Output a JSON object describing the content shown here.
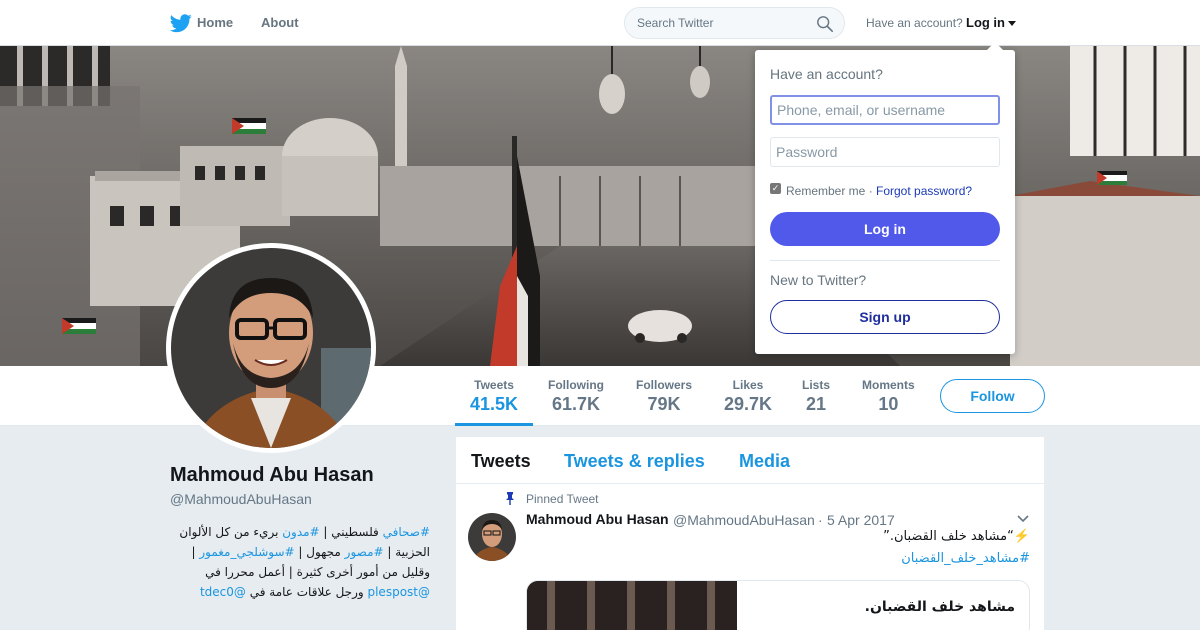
{
  "nav": {
    "home_label": "Home",
    "about_label": "About",
    "search_placeholder": "Search Twitter",
    "have_account": "Have an account?",
    "login_label": "Log in",
    "icons": {
      "logo": "twitter-bird-icon",
      "search": "search-icon",
      "caret": "caret-down-icon"
    }
  },
  "colors": {
    "brand": "#1b95e0",
    "login_button": "#5059ea",
    "page_bg": "#e6ecf0"
  },
  "profile": {
    "name": "Mahmoud Abu Hasan",
    "handle": "@MahmoudAbuHasan",
    "bio": {
      "line1_tag1": "#صحافي",
      "line1_text1": " فلسطيني | ",
      "line1_tag2": "#مدون",
      "line1_text2": " بريء من كل الألوان الحزبية | ",
      "line2_tag": "#مصور",
      "line2_text": " مجهول | ",
      "line3_tag": "#سوشلجي_مغمور",
      "line3_text": " | وقليل من أمور أخرى كثيرة | أعمل محررا في ",
      "mention1": "@plespost",
      "line4_text": " ورجل علاقات عامة في ",
      "mention2": "@tdec0"
    }
  },
  "stats": [
    {
      "label": "Tweets",
      "value": "41.5K",
      "active": true
    },
    {
      "label": "Following",
      "value": "61.7K"
    },
    {
      "label": "Followers",
      "value": "79K"
    },
    {
      "label": "Likes",
      "value": "29.7K"
    },
    {
      "label": "Lists",
      "value": "21"
    },
    {
      "label": "Moments",
      "value": "10"
    }
  ],
  "follow_label": "Follow",
  "timeline": {
    "tabs": [
      "Tweets",
      "Tweets & replies",
      "Media"
    ],
    "pinned_label": "Pinned Tweet",
    "tweet": {
      "name": "Mahmoud Abu Hasan",
      "handle": "@MahmoudAbuHasan",
      "dot": "·",
      "date": "5 Apr 2017",
      "text": "⚡️“مشاهد خلف القضبان.”",
      "hashtag": "#مشاهد_خلف_القضبان",
      "card_title": "مشاهد خلف القضبان."
    }
  },
  "login_dropdown": {
    "title": "Have an account?",
    "username_placeholder": "Phone, email, or username",
    "password_placeholder": "Password",
    "remember": "Remember me",
    "sep": " · ",
    "forgot": "Forgot password?",
    "login_button": "Log in",
    "new_to": "New to Twitter?",
    "signup": "Sign up"
  }
}
